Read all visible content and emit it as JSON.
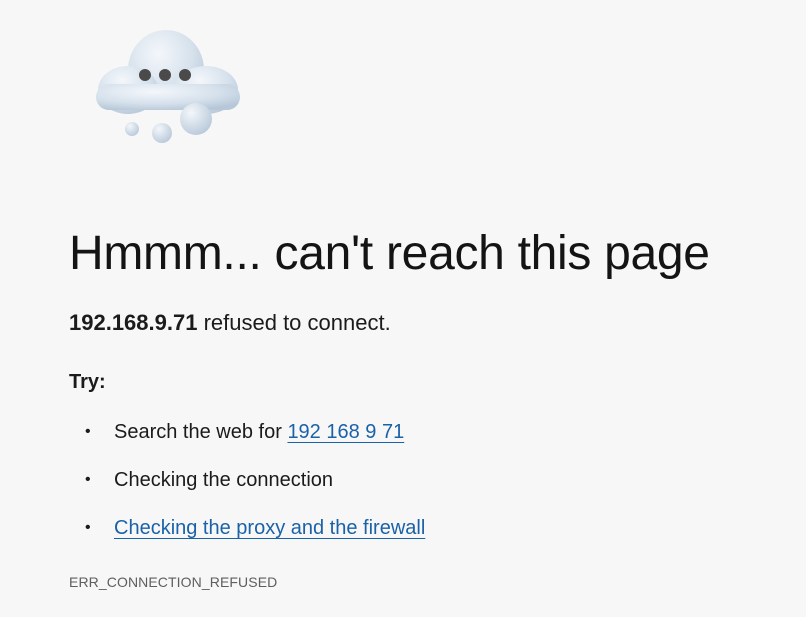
{
  "illustration": {
    "icon": "cloud-dots-icon",
    "colors": {
      "cloud": "#cfdbe8",
      "cloud_highlight": "#f2f6fa",
      "dots": "#4a4a4a"
    }
  },
  "title": "Hmmm... can't reach this page",
  "subtitle": {
    "host": "192.168.9.71",
    "message": " refused to connect."
  },
  "try_heading": "Try:",
  "suggestions": {
    "search_prefix": "Search the web for ",
    "search_link": "192 168 9 71",
    "check_connection": "Checking the connection",
    "check_proxy": "Checking the proxy and the firewall"
  },
  "bullet": "•",
  "error_code": "ERR_CONNECTION_REFUSED",
  "colors": {
    "background": "#f7f7f7",
    "link": "#1a62a8",
    "text": "#1b1b1b",
    "muted": "#5e5e5e"
  }
}
